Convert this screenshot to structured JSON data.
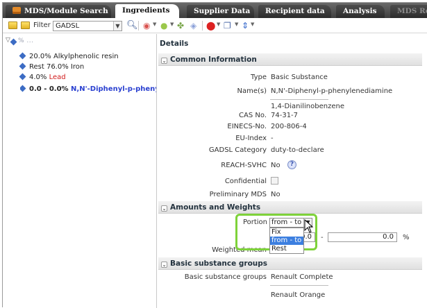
{
  "tabs": [
    {
      "label": "MDS/Module Search"
    },
    {
      "label": "Ingredients"
    },
    {
      "label": "Supplier Data"
    },
    {
      "label": "Recipient data"
    },
    {
      "label": "Analysis"
    },
    {
      "label": "MDS Re"
    }
  ],
  "toolbar": {
    "filter_label": "Filter",
    "filter_value": "GADSL"
  },
  "tree": {
    "root_label": "% ...",
    "items": [
      {
        "prefix": "20.0%",
        "name": "Alkylphenolic resin"
      },
      {
        "prefix": "Rest 76.0%",
        "name": "Iron"
      },
      {
        "prefix": "4.0%",
        "name": "Lead"
      },
      {
        "prefix": "0.0 - 0.0%",
        "name": "N,N'-Diphenyl-p-phenylenediamine"
      }
    ]
  },
  "details": {
    "title": "Details",
    "common": {
      "header": "Common Information",
      "type_label": "Type",
      "type_value": "Basic Substance",
      "names_label": "Name(s)",
      "name1": "N,N'-Diphenyl-p-phenylenediamine",
      "name2": "1,4-Dianilinobenzene",
      "cas_label": "CAS No.",
      "cas_value": "74-31-7",
      "einecs_label": "EINECS-No.",
      "einecs_value": "200-806-4",
      "euindex_label": "EU-Index",
      "euindex_value": "-",
      "gadsl_label": "GADSL Category",
      "gadsl_value": "duty-to-declare",
      "reach_label": "REACH-SVHC",
      "reach_value": "No",
      "confidential_label": "Confidential",
      "prelim_label": "Preliminary MDS",
      "prelim_value": "No"
    },
    "amounts": {
      "header": "Amounts and Weights",
      "portion_label": "Portion",
      "portion_value": "from - to",
      "options": [
        "Fix",
        "from - to",
        "Rest"
      ],
      "from_value": "0.0",
      "dash": "-",
      "to_value": "0.0",
      "unit": "%",
      "weighted_label": "Weighted mean"
    },
    "groups": {
      "header": "Basic substance groups",
      "label": "Basic substance groups",
      "value1": "Renault Complete",
      "value2": "Renault Orange"
    }
  },
  "colors": {
    "highlight": "#7ed23a",
    "selected_option": "#3c7fe0",
    "lead_red": "#d11b1b",
    "selected_blue": "#2a40d0"
  }
}
